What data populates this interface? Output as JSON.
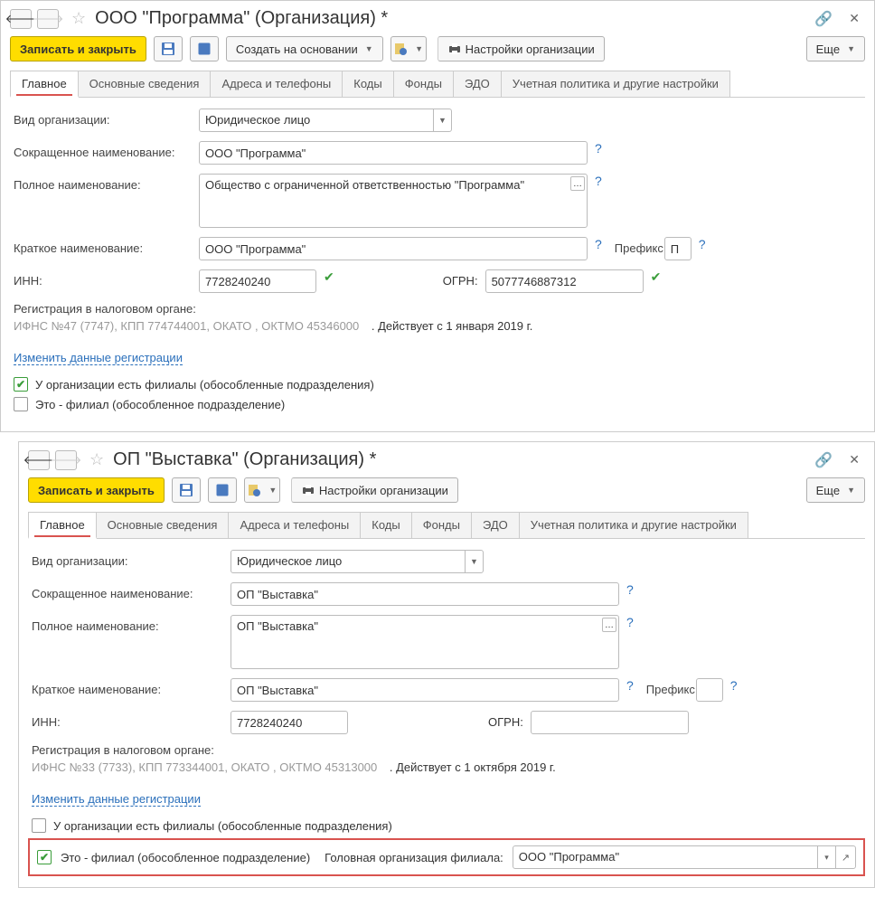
{
  "window1": {
    "title": "ООО \"Программа\" (Организация) *",
    "toolbar": {
      "save_close": "Записать и закрыть",
      "create_based": "Создать на основании",
      "org_settings": "Настройки организации",
      "more": "Еще"
    },
    "tabs": [
      "Главное",
      "Основные сведения",
      "Адреса и телефоны",
      "Коды",
      "Фонды",
      "ЭДО",
      "Учетная политика и другие настройки"
    ],
    "labels": {
      "org_type": "Вид организации:",
      "short_name": "Сокращенное наименование:",
      "full_name": "Полное наименование:",
      "brief_name": "Краткое наименование:",
      "prefix": "Префикс:",
      "inn": "ИНН:",
      "ogrn": "ОГРН:",
      "reg_heading": "Регистрация в налоговом органе:",
      "edit_reg": "Изменить данные регистрации",
      "has_branches": "У организации есть филиалы (обособленные подразделения)",
      "is_branch": "Это - филиал (обособленное подразделение)"
    },
    "values": {
      "org_type": "Юридическое лицо",
      "short_name": "ООО \"Программа\"",
      "full_name": "Общество с ограниченной ответственностью \"Программа\"",
      "brief_name": "ООО \"Программа\"",
      "prefix": "П",
      "inn": "7728240240",
      "ogrn": "5077746887312",
      "reg_info": "ИФНС №47 (7747), КПП 774744001, ОКАТО , ОКТМО 45346000",
      "reg_date": ". Действует с 1 января 2019 г."
    },
    "checks": {
      "has_branches": true,
      "is_branch": false
    }
  },
  "window2": {
    "title": "ОП \"Выставка\" (Организация) *",
    "toolbar": {
      "save_close": "Записать и закрыть",
      "org_settings": "Настройки организации",
      "more": "Еще"
    },
    "tabs": [
      "Главное",
      "Основные сведения",
      "Адреса и телефоны",
      "Коды",
      "Фонды",
      "ЭДО",
      "Учетная политика и другие настройки"
    ],
    "labels": {
      "org_type": "Вид организации:",
      "short_name": "Сокращенное наименование:",
      "full_name": "Полное наименование:",
      "brief_name": "Краткое наименование:",
      "prefix": "Префикс:",
      "inn": "ИНН:",
      "ogrn": "ОГРН:",
      "reg_heading": "Регистрация в налоговом органе:",
      "edit_reg": "Изменить данные регистрации",
      "has_branches": "У организации есть филиалы (обособленные подразделения)",
      "is_branch": "Это - филиал (обособленное подразделение)",
      "parent_org": "Головная организация филиала:"
    },
    "values": {
      "org_type": "Юридическое лицо",
      "short_name": "ОП \"Выставка\"",
      "full_name": "ОП \"Выставка\"",
      "brief_name": "ОП \"Выставка\"",
      "prefix": "",
      "inn": "7728240240",
      "ogrn": "",
      "reg_info": "ИФНС №33 (7733), КПП 773344001, ОКАТО , ОКТМО 45313000",
      "reg_date": ". Действует с 1 октября 2019 г.",
      "parent_org": "ООО \"Программа\""
    },
    "checks": {
      "has_branches": false,
      "is_branch": true
    }
  }
}
